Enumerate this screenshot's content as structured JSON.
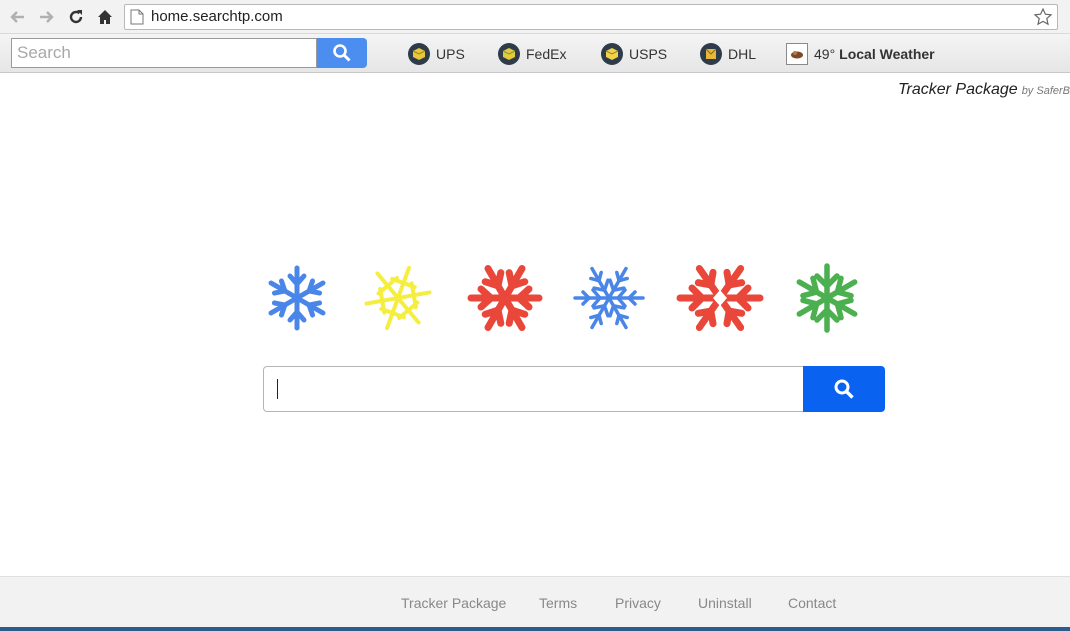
{
  "browser": {
    "url": "home.searchtp.com",
    "icons": [
      "back-arrow-icon",
      "forward-arrow-icon",
      "reload-icon",
      "home-icon",
      "page-icon",
      "star-icon"
    ]
  },
  "toolbar": {
    "search_placeholder": "Search",
    "links": [
      {
        "label": "UPS",
        "icon": "ups-icon"
      },
      {
        "label": "FedEx",
        "icon": "fedex-icon"
      },
      {
        "label": "USPS",
        "icon": "usps-icon"
      },
      {
        "label": "DHL",
        "icon": "dhl-icon"
      }
    ],
    "weather": {
      "temp": "49°",
      "label": "Local Weather",
      "icon": "weather-icon"
    }
  },
  "brand": {
    "name": "Tracker Package",
    "by": "by SaferB"
  },
  "decor": {
    "snowflake_colors": [
      "#4a86e8",
      "#f5ee3f",
      "#e8473a",
      "#4a86e8",
      "#e8473a",
      "#4caf50"
    ]
  },
  "main_search": {
    "value": "",
    "button_icon": "search-icon",
    "button_color": "#0a63f0"
  },
  "footer": {
    "links": [
      "Tracker Package",
      "Terms",
      "Privacy",
      "Uninstall",
      "Contact"
    ]
  }
}
